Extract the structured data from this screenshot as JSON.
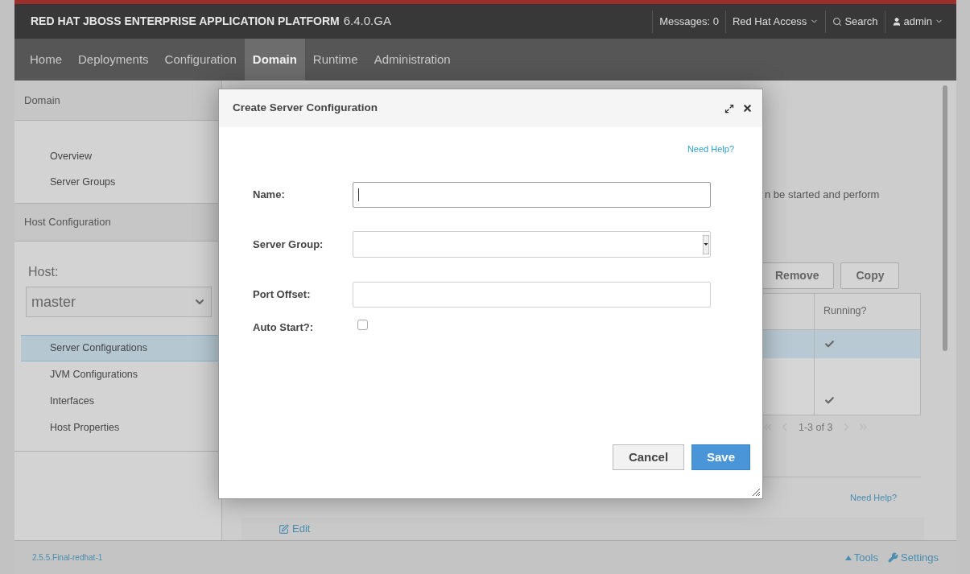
{
  "header": {
    "brand": "RED HAT JBOSS ENTERPRISE APPLICATION PLATFORM",
    "version": "6.4.0.GA",
    "messages": "Messages: 0",
    "access": "Red Hat Access",
    "search": "Search",
    "user": "admin"
  },
  "nav": [
    {
      "label": "Home",
      "selected": false
    },
    {
      "label": "Deployments",
      "selected": false
    },
    {
      "label": "Configuration",
      "selected": false
    },
    {
      "label": "Domain",
      "selected": true
    },
    {
      "label": "Runtime",
      "selected": false
    },
    {
      "label": "Administration",
      "selected": false
    }
  ],
  "sidebar": {
    "section": "Domain",
    "items": [
      {
        "label": "Overview",
        "selected": false
      },
      {
        "label": "Server Groups",
        "selected": false
      }
    ],
    "host_section": "Host Configuration",
    "host_label": "Host:",
    "host_value": "master",
    "host_items": [
      {
        "label": "Server Configurations",
        "selected": true
      },
      {
        "label": "JVM Configurations",
        "selected": false
      },
      {
        "label": "Interfaces",
        "selected": false
      },
      {
        "label": "Host Properties",
        "selected": false
      }
    ]
  },
  "main": {
    "description": "n be started and perform",
    "buttons": [
      "Remove",
      "Copy"
    ],
    "table": {
      "column": "Running?",
      "rows": [
        {
          "running": true,
          "selected": true
        },
        {
          "running": false,
          "selected": false
        },
        {
          "running": true,
          "selected": false
        }
      ]
    },
    "pagination": "1-3 of 3",
    "help": "Need Help?",
    "edit": "Edit"
  },
  "dialog": {
    "title": "Create Server Configuration",
    "help": "Need Help?",
    "fields": [
      {
        "kind": "text",
        "label": "Name:",
        "focused": true
      },
      {
        "kind": "select",
        "label": "Server Group:"
      },
      {
        "kind": "text",
        "label": "Port Offset:",
        "focused": false
      },
      {
        "kind": "checkbox",
        "label": "Auto Start?:",
        "checked": false
      }
    ],
    "cancel": "Cancel",
    "save": "Save"
  },
  "footer": {
    "version": "2.5.5.Final-redhat-1",
    "tools": "Tools",
    "settings": "Settings"
  }
}
